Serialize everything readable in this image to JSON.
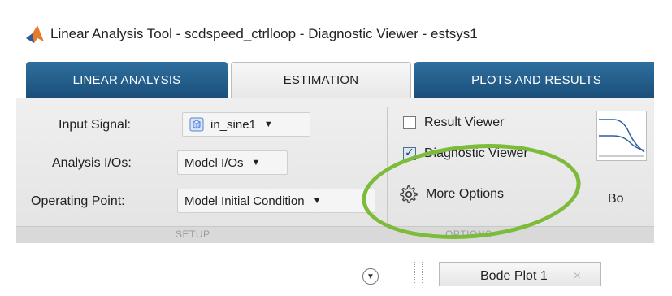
{
  "window": {
    "title": "Linear Analysis Tool - scdspeed_ctrlloop - Diagnostic Viewer - estsys1"
  },
  "tabs": [
    {
      "label": "LINEAR ANALYSIS",
      "active": false
    },
    {
      "label": "ESTIMATION",
      "active": true
    },
    {
      "label": "PLOTS AND RESULTS",
      "active": false
    }
  ],
  "setup": {
    "input_signal_label": "Input Signal:",
    "input_signal_value": "in_sine1",
    "analysis_ios_label": "Analysis I/Os:",
    "analysis_ios_value": "Model I/Os",
    "operating_point_label": "Operating Point:",
    "operating_point_value": "Model Initial Condition",
    "section_label": "SETUP"
  },
  "options": {
    "result_viewer_label": "Result Viewer",
    "result_viewer_checked": false,
    "diagnostic_viewer_label": "Diagnostic Viewer",
    "diagnostic_viewer_checked": true,
    "more_options_label": "More Options",
    "section_label": "OPTIONS"
  },
  "plots": {
    "thumb_label": "Bo"
  },
  "document_tabs": [
    {
      "label": "Bode Plot 1"
    }
  ],
  "colors": {
    "tab_blue": "#1b4f7a",
    "highlight_green": "#7dbb3a"
  }
}
